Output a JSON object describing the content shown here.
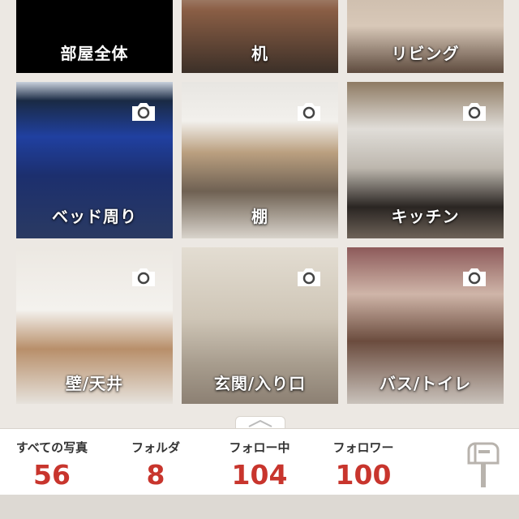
{
  "folders": [
    {
      "label": "部屋全体",
      "has_photo_icon": false
    },
    {
      "label": "机",
      "has_photo_icon": false
    },
    {
      "label": "リビング",
      "has_photo_icon": false
    },
    {
      "label": "ベッド周り",
      "has_photo_icon": true
    },
    {
      "label": "棚",
      "has_photo_icon": true
    },
    {
      "label": "キッチン",
      "has_photo_icon": true
    },
    {
      "label": "壁/天井",
      "has_photo_icon": true
    },
    {
      "label": "玄関/入り口",
      "has_photo_icon": true
    },
    {
      "label": "バス/トイレ",
      "has_photo_icon": true
    }
  ],
  "stats": {
    "all_photos": {
      "label": "すべての写真",
      "value": "56"
    },
    "folders": {
      "label": "フォルダ",
      "value": "8"
    },
    "following": {
      "label": "フォロー中",
      "value": "104"
    },
    "followers": {
      "label": "フォロワー",
      "value": "100"
    }
  },
  "icons": {
    "camera": "camera-icon",
    "mailbox": "mailbox-icon",
    "handle": "chevron-up-icon"
  },
  "colors": {
    "accent": "#c8352d",
    "background": "#ece8e3",
    "panel": "#ffffff"
  }
}
